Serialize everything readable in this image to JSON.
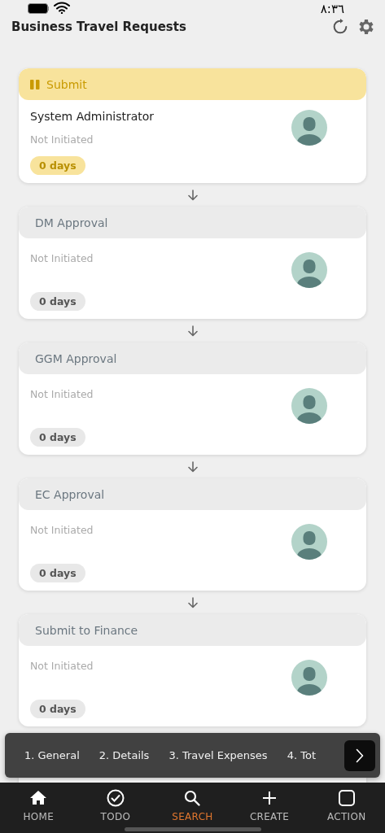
{
  "status_bar": {
    "time": "٨:٣٦"
  },
  "header": {
    "title": "Business Travel Requests"
  },
  "steps": [
    {
      "title": "Submit",
      "kind": "active",
      "assignee": "System Administrator",
      "status": "Not Initiated",
      "duration": "0 days"
    },
    {
      "title": "DM Approval",
      "kind": "pending",
      "status": "Not Initiated",
      "duration": "0 days"
    },
    {
      "title": "GGM Approval",
      "kind": "pending",
      "status": "Not Initiated",
      "duration": "0 days"
    },
    {
      "title": "EC Approval",
      "kind": "pending",
      "status": "Not Initiated",
      "duration": "0 days"
    },
    {
      "title": "Submit to Finance",
      "kind": "pending",
      "status": "Not Initiated",
      "duration": "0 days"
    }
  ],
  "form_sections": [
    {
      "label": "1. General"
    },
    {
      "label": "2. Details"
    },
    {
      "label": "3. Travel Expenses"
    },
    {
      "label": "4. Tot"
    }
  ],
  "tab_bar": [
    {
      "label": "HOME",
      "kind": "home",
      "selected": false
    },
    {
      "label": "TODO",
      "kind": "check",
      "selected": false
    },
    {
      "label": "SEARCH",
      "kind": "search",
      "selected": true
    },
    {
      "label": "CREATE",
      "kind": "plus",
      "selected": false
    },
    {
      "label": "ACTION",
      "kind": "square",
      "selected": false
    }
  ]
}
